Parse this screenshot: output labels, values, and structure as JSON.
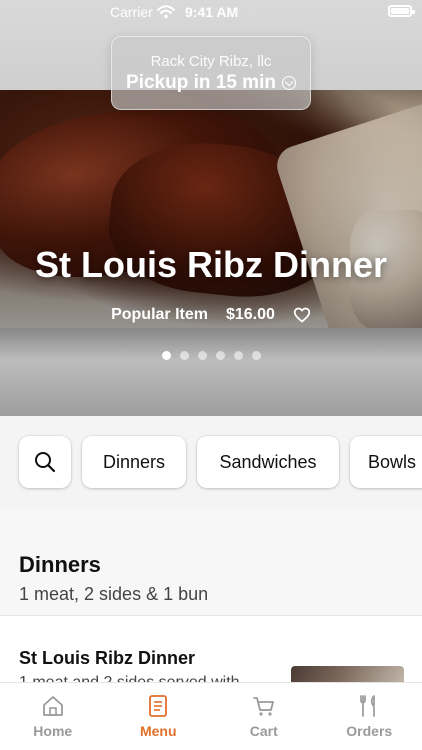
{
  "status_bar": {
    "carrier": "Carrier",
    "time": "9:41 AM"
  },
  "header": {
    "restaurant": "Rack City Ribz, llc",
    "pickup": "Pickup in 15 min"
  },
  "hero": {
    "title": "St Louis Ribz Dinner",
    "badge": "Popular Item",
    "price": "$16.00",
    "dots_total": 6,
    "dots_active": 1
  },
  "categories": [
    {
      "label": "Dinners"
    },
    {
      "label": "Sandwiches"
    },
    {
      "label": "Bowls"
    }
  ],
  "section": {
    "title": "Dinners",
    "subtitle": "1 meat, 2 sides & 1 bun"
  },
  "item": {
    "name": "St Louis Ribz Dinner",
    "description_partial": "1 meat and 2 sides served with"
  },
  "tabs": [
    {
      "label": "Home",
      "icon": "home-icon",
      "active": false
    },
    {
      "label": "Menu",
      "icon": "menu-icon",
      "active": true
    },
    {
      "label": "Cart",
      "icon": "cart-icon",
      "active": false
    },
    {
      "label": "Orders",
      "icon": "orders-icon",
      "active": false
    }
  ],
  "colors": {
    "accent": "#e0702a",
    "tab_inactive": "#9a9a9a"
  }
}
